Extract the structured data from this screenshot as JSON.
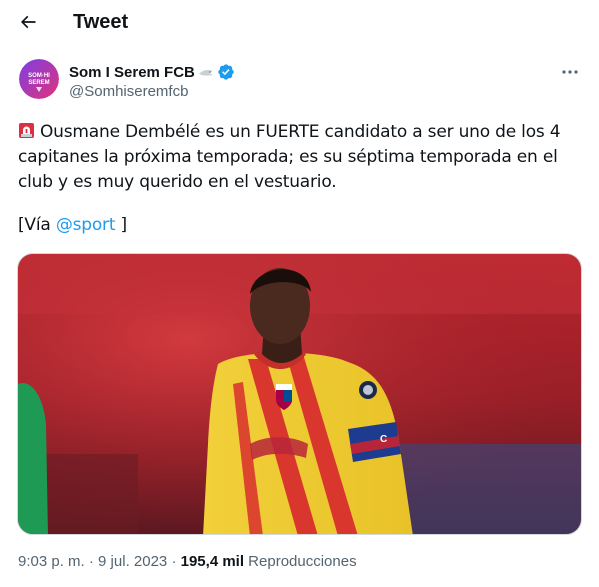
{
  "header": {
    "title": "Tweet",
    "back_icon": "arrow-left-icon"
  },
  "author": {
    "display_name": "Som I Serem FCB",
    "name_suffix_emoji": "bird-emoji",
    "verified_badge": "verified-badge-icon",
    "handle": "@Somhiseremfcb",
    "avatar_text": "SOM·HI SEREM",
    "colors": {
      "avatar_gradient_start": "#7b3fe4",
      "avatar_gradient_end": "#e2327a"
    }
  },
  "tweet": {
    "lead_icon": "siren-icon",
    "text": "Ousmane Dembélé es un FUERTE candidato a ser uno de los 4 capitanes la próxima temporada; es su séptima temporada en el club y es muy querido en el vestuario.",
    "via_open": "[Vía ",
    "via_mention": "@sport",
    "via_close": " ]"
  },
  "media": {
    "image_description_icon": "player-photo",
    "armband_text": "C"
  },
  "meta": {
    "time": "9:03 p. m.",
    "separator": " · ",
    "date": "9 jul. 2023",
    "views_count": "195,4 mil",
    "views_label": " Reproducciones"
  },
  "colors": {
    "accent": "#1d9bf0",
    "text_primary": "#0f1419",
    "text_secondary": "#536471",
    "verified": "#1d9bf0"
  }
}
